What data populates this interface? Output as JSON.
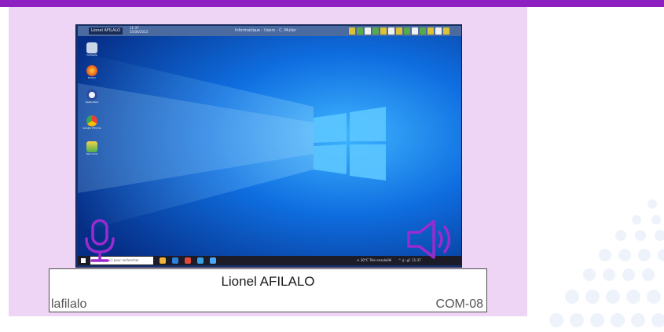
{
  "colors": {
    "accent": "#8e1fc0",
    "card_background": "#efd5f5",
    "mic_icon": "#9b2bd0",
    "speaker_icon": "#9b2bd0"
  },
  "remote_screen": {
    "session_user": "Lionel AFILALO",
    "session_time": "11:37",
    "session_date": "25/06/2023",
    "window_title": "Informatique - Users - C. Muller",
    "desktop_icons": [
      {
        "icon": "recycle-bin-icon",
        "label": "Corbeille"
      },
      {
        "icon": "firefox-icon",
        "label": "Firefox"
      },
      {
        "icon": "app-icon",
        "label": "Application"
      },
      {
        "icon": "chrome-icon",
        "label": "Google Chrome"
      },
      {
        "icon": "folder-icon",
        "label": "Raccourci"
      }
    ],
    "taskbar": {
      "search_placeholder": "Taper ici pour rechercher",
      "weather": "☀ 30°C Très ensoleillé",
      "clock": "^ 𝄞 ⁝ 🔊 11:37"
    }
  },
  "icons": {
    "microphone": "microphone-icon",
    "speaker": "speaker-icon"
  },
  "station": {
    "user_name": "Lionel AFILALO",
    "login": "lafilalo",
    "hostname": "COM-08"
  }
}
